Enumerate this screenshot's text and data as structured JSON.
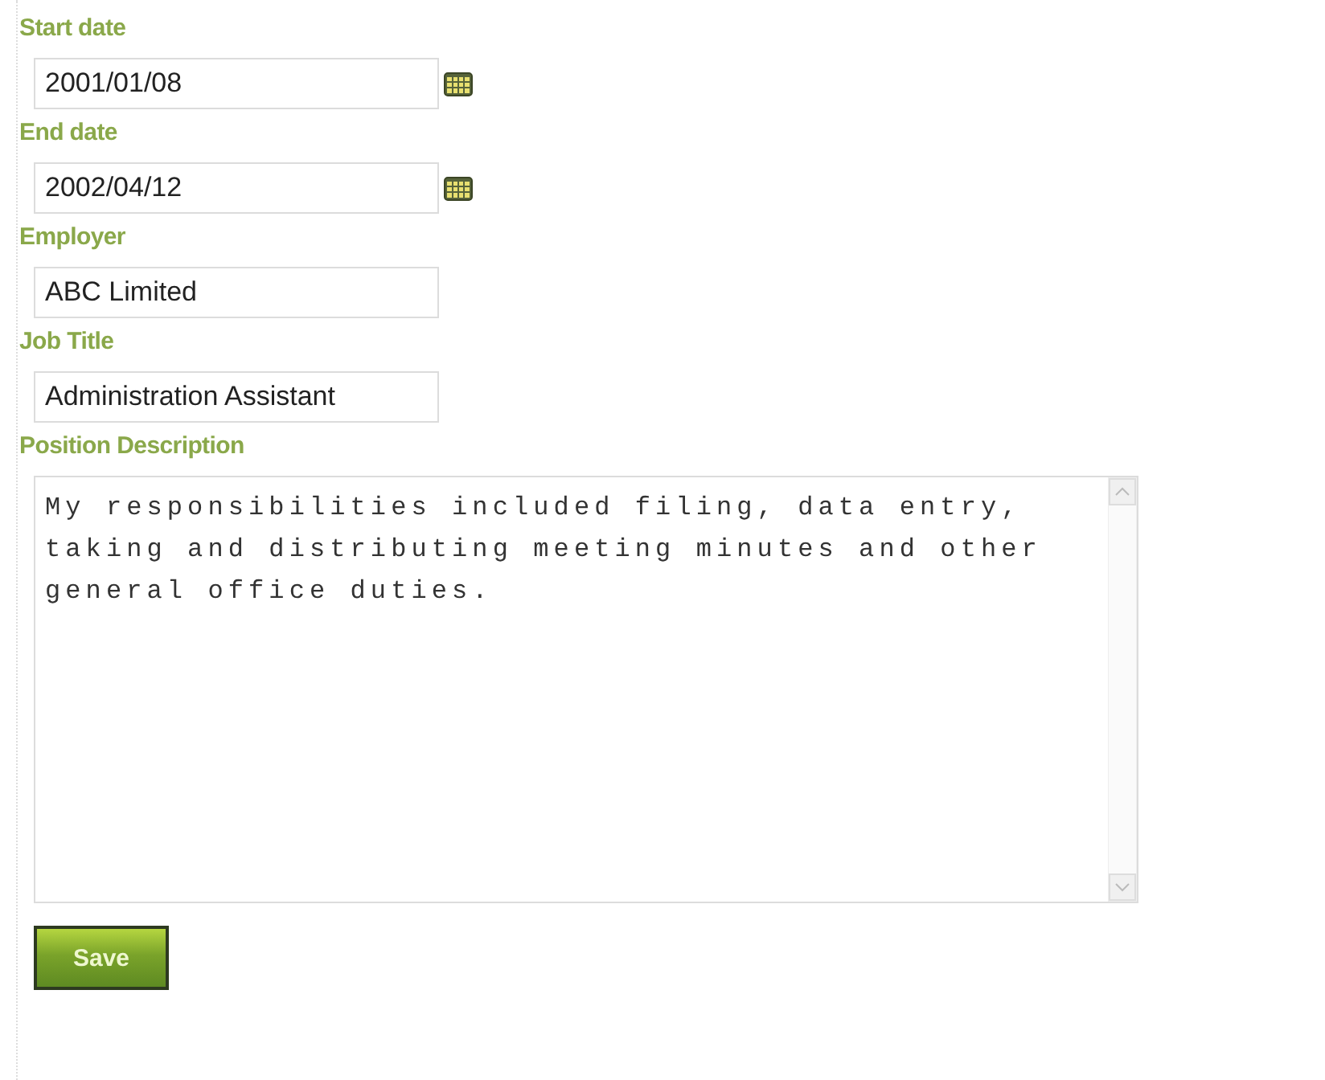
{
  "fields": [
    {
      "kind": "date",
      "label": "Start date",
      "value": "2001/01/08"
    },
    {
      "kind": "date",
      "label": "End date",
      "value": "2002/04/12"
    },
    {
      "kind": "text",
      "label": "Employer",
      "value": "ABC Limited"
    },
    {
      "kind": "text",
      "label": "Job Title",
      "value": "Administration Assistant"
    },
    {
      "kind": "textarea",
      "label": "Position Description",
      "value": "My responsibilities included filing, data entry, taking and distributing meeting minutes and other general office duties."
    }
  ],
  "buttons": [
    "Save"
  ]
}
